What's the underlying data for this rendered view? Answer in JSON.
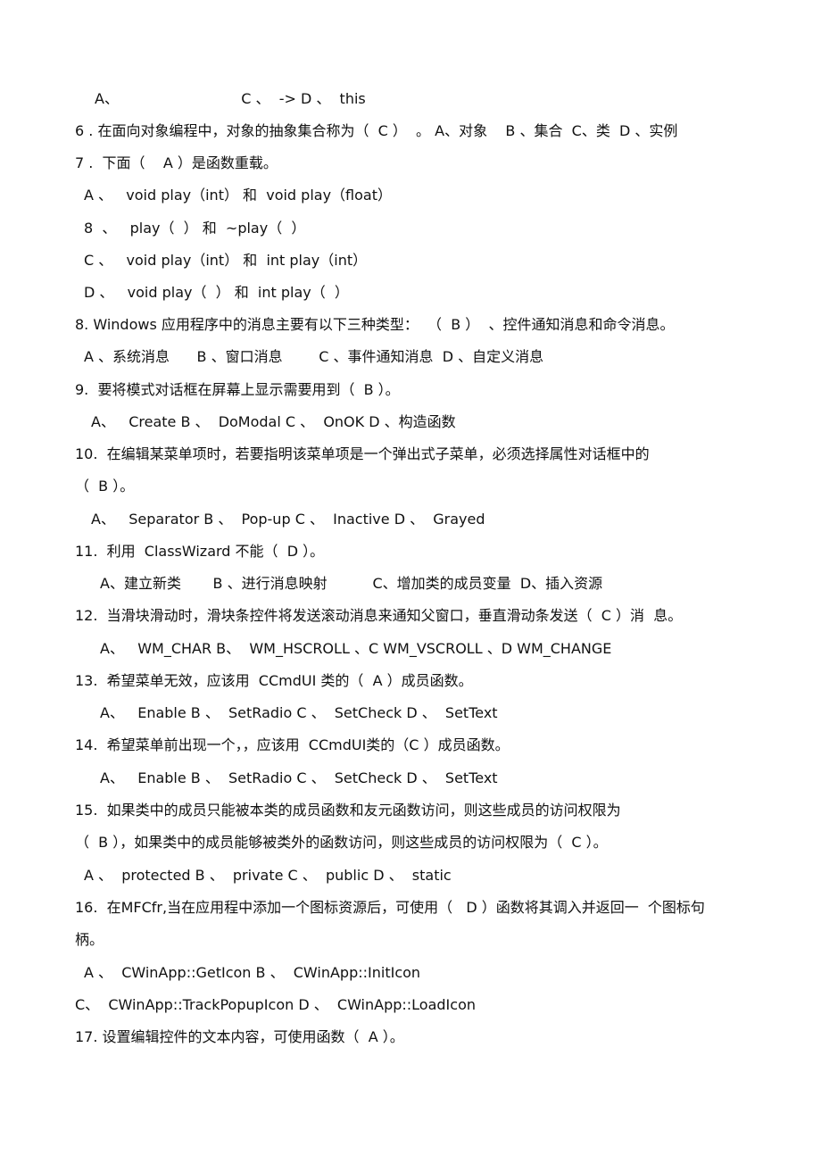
{
  "document": {
    "lines": [
      {
        "id": "q5-options",
        "text": "A、                           C 、  -> D 、  this"
      },
      {
        "id": "q6",
        "text": "6 . 在面向对象编程中，对象的抽象集合称为（  C ）  。 A、对象    B 、集合  C、类  D 、实例"
      },
      {
        "id": "q7",
        "text": "7 .  下面（    A ）是函数重载。"
      },
      {
        "id": "q7-a",
        "text": "A 、   void play（int） 和  void play（float）"
      },
      {
        "id": "q7-b",
        "text": "8  、   play（  ） 和  ~play（  ）"
      },
      {
        "id": "q7-c",
        "text": "C 、   void play（int） 和  int play（int）"
      },
      {
        "id": "q7-d",
        "text": "D 、   void play（  ） 和  int play（  ）"
      },
      {
        "id": "q8",
        "text": "8. Windows 应用程序中的消息主要有以下三种类型：  （  B ）  、控件通知消息和命令消息。"
      },
      {
        "id": "q8-options",
        "text": "A 、系统消息      B 、窗口消息        C 、事件通知消息  D 、自定义消息"
      },
      {
        "id": "q9",
        "text": "9.  要将模式对话框在屏幕上显示需要用到（  B ）。"
      },
      {
        "id": "q9-options",
        "text": "A、   Create B 、  DoModal C 、  OnOK D 、构造函数"
      },
      {
        "id": "q10",
        "text": "10.  在编辑某菜单项时，若要指明该菜单项是一个弹出式子菜单，必须选择属性对话框中的"
      },
      {
        "id": "q10-cont",
        "text": "（  B ）。"
      },
      {
        "id": "q10-options",
        "text": "A、   Separator B 、  Pop-up C 、  Inactive D 、  Grayed"
      },
      {
        "id": "q11",
        "text": "11.  利用  ClassWizard 不能（  D ）。"
      },
      {
        "id": "q11-options",
        "text": "A、建立新类       B 、进行消息映射          C、增加类的成员变量  D、插入资源"
      },
      {
        "id": "q12",
        "text": "12.  当滑块滑动时，滑块条控件将发送滚动消息来通知父窗口，垂直滑动条发送（  C ）消  息。"
      },
      {
        "id": "q12-options",
        "text": "A、   WM_CHAR B、  WM_HSCROLL 、C WM_VSCROLL 、D WM_CHANGE"
      },
      {
        "id": "q13",
        "text": "13.  希望菜单无效，应该用  CCmdUI 类的（  A ）成员函数。"
      },
      {
        "id": "q13-options",
        "text": "A、   Enable B 、  SetRadio C 、  SetCheck D 、  SetText"
      },
      {
        "id": "q14",
        "text": "14.  希望菜单前出现一个，，应该用  CCmdUI类的（C ）成员函数。"
      },
      {
        "id": "q14-options",
        "text": "A、   Enable B 、  SetRadio C 、  SetCheck D 、  SetText"
      },
      {
        "id": "q15",
        "text": "15.  如果类中的成员只能被本类的成员函数和友元函数访问，则这些成员的访问权限为"
      },
      {
        "id": "q15-cont",
        "text": "（  B ），如果类中的成员能够被类外的函数访问，则这些成员的访问权限为（  C ）。"
      },
      {
        "id": "q15-options",
        "text": "A 、  protected B 、  private C 、  public D 、  static"
      },
      {
        "id": "q16",
        "text": "16.  在MFCfr,当在应用程中添加一个图标资源后，可使用（   D ）函数将其调入并返回一  个图标句"
      },
      {
        "id": "q16-cont",
        "text": "柄。"
      },
      {
        "id": "q16-options-ab",
        "text": "A 、  CWinApp::GetIcon B 、  CWinApp::InitIcon"
      },
      {
        "id": "q16-options-cd",
        "text": "C、  CWinApp::TrackPopupIcon D 、  CWinApp::LoadIcon"
      },
      {
        "id": "q17",
        "text": "17. 设置编辑控件的文本内容，可使用函数（  A ）。"
      }
    ]
  }
}
